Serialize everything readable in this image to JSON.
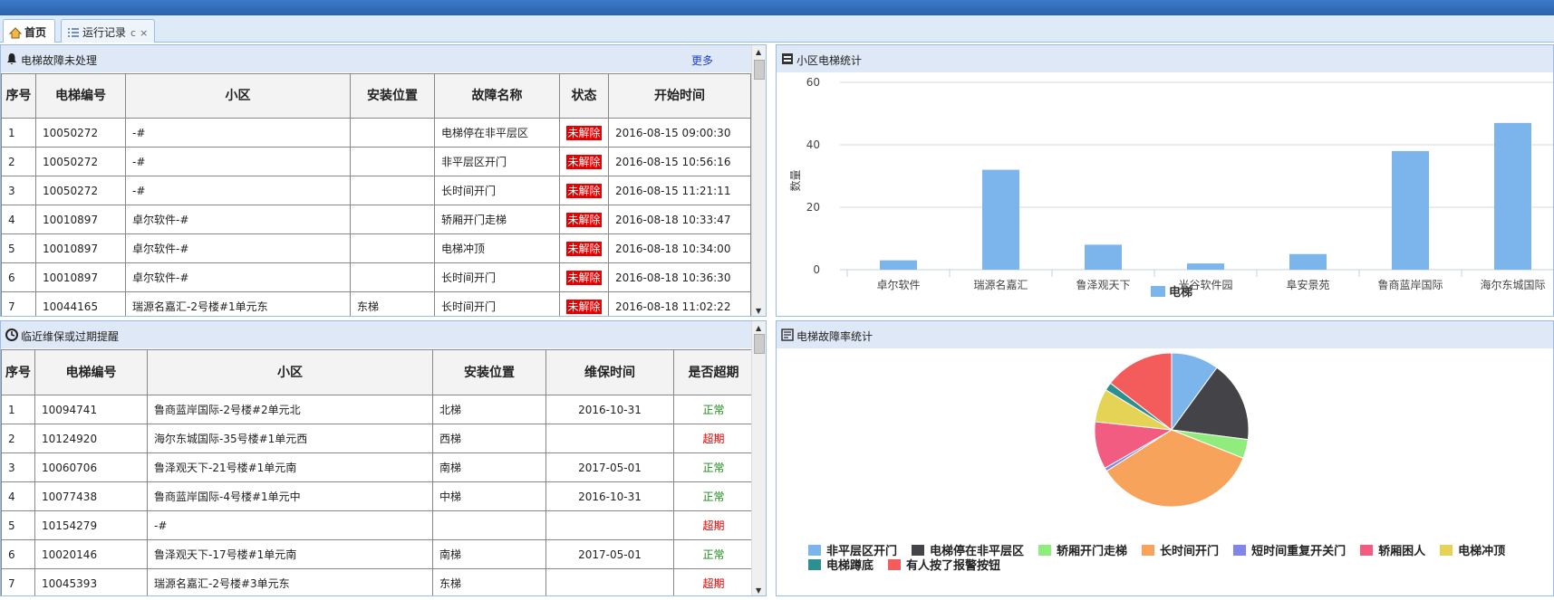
{
  "tabs": [
    {
      "label": "首页",
      "icon": "home-icon"
    },
    {
      "label": "运行记录",
      "icon": "list-icon",
      "refresh": "c",
      "close": "×"
    }
  ],
  "fault_panel": {
    "title": "电梯故障未处理",
    "more": "更多",
    "columns": [
      "序号",
      "电梯编号",
      "小区",
      "安装位置",
      "故障名称",
      "状态",
      "开始时间"
    ],
    "rows": [
      [
        "1",
        "10050272",
        "-#",
        "",
        "电梯停在非平层区",
        "未解除",
        "2016-08-15 09:00:30"
      ],
      [
        "2",
        "10050272",
        "-#",
        "",
        "非平层区开门",
        "未解除",
        "2016-08-15 10:56:16"
      ],
      [
        "3",
        "10050272",
        "-#",
        "",
        "长时间开门",
        "未解除",
        "2016-08-15 11:21:11"
      ],
      [
        "4",
        "10010897",
        "卓尔软件-#",
        "",
        "轿厢开门走梯",
        "未解除",
        "2016-08-18 10:33:47"
      ],
      [
        "5",
        "10010897",
        "卓尔软件-#",
        "",
        "电梯冲顶",
        "未解除",
        "2016-08-18 10:34:00"
      ],
      [
        "6",
        "10010897",
        "卓尔软件-#",
        "",
        "长时间开门",
        "未解除",
        "2016-08-18 10:36:30"
      ],
      [
        "7",
        "10044165",
        "瑞源名嘉汇-2号楼#1单元东",
        "东梯",
        "长时间开门",
        "未解除",
        "2016-08-18 11:02:22"
      ]
    ]
  },
  "maint_panel": {
    "title": "临近维保或过期提醒",
    "columns": [
      "序号",
      "电梯编号",
      "小区",
      "安装位置",
      "维保时间",
      "是否超期"
    ],
    "rows": [
      [
        "1",
        "10094741",
        "鲁商蓝岸国际-2号楼#2单元北",
        "北梯",
        "2016-10-31",
        "正常"
      ],
      [
        "2",
        "10124920",
        "海尔东城国际-35号楼#1单元西",
        "西梯",
        "",
        "超期"
      ],
      [
        "3",
        "10060706",
        "鲁泽观天下-21号楼#1单元南",
        "南梯",
        "2017-05-01",
        "正常"
      ],
      [
        "4",
        "10077438",
        "鲁商蓝岸国际-4号楼#1单元中",
        "中梯",
        "2016-10-31",
        "正常"
      ],
      [
        "5",
        "10154279",
        "-#",
        "",
        "",
        "超期"
      ],
      [
        "6",
        "10020146",
        "鲁泽观天下-17号楼#1单元南",
        "南梯",
        "2017-05-01",
        "正常"
      ],
      [
        "7",
        "10045393",
        "瑞源名嘉汇-2号楼#3单元东",
        "东梯",
        "",
        "超期"
      ]
    ]
  },
  "bar_panel": {
    "title": "小区电梯统计"
  },
  "pie_panel": {
    "title": "电梯故障率统计"
  },
  "colors": {
    "ok": "#1c8a1c",
    "over": "#e00000",
    "badge": "#e60000",
    "bar": "#7cb5ec"
  },
  "chart_data": [
    {
      "type": "bar",
      "title": "",
      "ylabel": "数量",
      "ylim": [
        0,
        60
      ],
      "yticks": [
        0,
        20,
        40,
        60
      ],
      "categories": [
        "卓尔软件",
        "瑞源名嘉汇",
        "鲁泽观天下",
        "光谷软件园",
        "阜安景苑",
        "鲁商蓝岸国际",
        "海尔东城国际"
      ],
      "series": [
        {
          "name": "电梯",
          "color": "#7cb5ec",
          "values": [
            3,
            32,
            8,
            2,
            5,
            38,
            47
          ]
        }
      ],
      "legend": "bottom",
      "grid": true
    },
    {
      "type": "pie",
      "title": "",
      "slices": [
        {
          "name": "非平层区开门",
          "value": 10,
          "color": "#7cb5ec"
        },
        {
          "name": "电梯停在非平层区",
          "value": 17,
          "color": "#434348"
        },
        {
          "name": "轿厢开门走梯",
          "value": 4,
          "color": "#90ed7d"
        },
        {
          "name": "长时间开门",
          "value": 35,
          "color": "#f7a35c"
        },
        {
          "name": "短时间重复开关门",
          "value": 0.7,
          "color": "#8085e9"
        },
        {
          "name": "轿厢困人",
          "value": 10,
          "color": "#f15c80"
        },
        {
          "name": "电梯冲顶",
          "value": 7,
          "color": "#e4d354"
        },
        {
          "name": "电梯蹲底",
          "value": 1.7,
          "color": "#2b908f"
        },
        {
          "name": "有人按了报警按钮",
          "value": 14.6,
          "color": "#f45b5b"
        }
      ],
      "legend": "bottom"
    }
  ]
}
